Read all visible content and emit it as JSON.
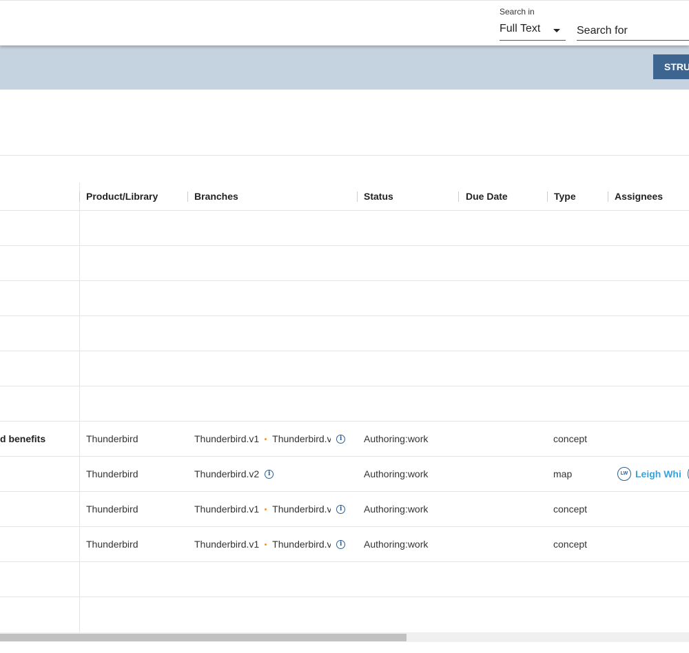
{
  "search": {
    "search_in_label": "Search in",
    "scope_value": "Full Text",
    "placeholder": "Search for"
  },
  "toolbar": {
    "struct_button_label": "STRUC"
  },
  "table": {
    "columns": [
      "Product/Library",
      "Branches",
      "Status",
      "Due Date",
      "Type",
      "Assignees"
    ],
    "rows": [
      {},
      {},
      {},
      {},
      {},
      {},
      {
        "title": "d benefits",
        "product": "Thunderbird",
        "branch1": "Thunderbird.v1",
        "branch2": "Thunderbird.v",
        "status": "Authoring:work",
        "due": "",
        "type": "concept"
      },
      {
        "title": "",
        "product": "Thunderbird",
        "branch1": "Thunderbird.v2",
        "branch2": "",
        "status": "Authoring:work",
        "due": "",
        "type": "map",
        "assignee_initials": "LW",
        "assignee_name": "Leigh White"
      },
      {
        "title": "",
        "product": "Thunderbird",
        "branch1": "Thunderbird.v1",
        "branch2": "Thunderbird.v",
        "status": "Authoring:work",
        "due": "",
        "type": "concept"
      },
      {
        "title": "",
        "product": "Thunderbird",
        "branch1": "Thunderbird.v1",
        "branch2": "Thunderbird.v",
        "status": "Authoring:work",
        "due": "",
        "type": "concept"
      },
      {},
      {}
    ]
  },
  "colors": {
    "band": "#c5d2df",
    "primary_button": "#3d6590",
    "branch_dot": "#f0932b",
    "assignee_link": "#3aa0dc",
    "icon": "#2f5d8c"
  },
  "icons": {
    "scope_dropdown": "caret-down-icon",
    "branch_info": "info-icon",
    "assignee_avatar": "avatar-icon"
  }
}
